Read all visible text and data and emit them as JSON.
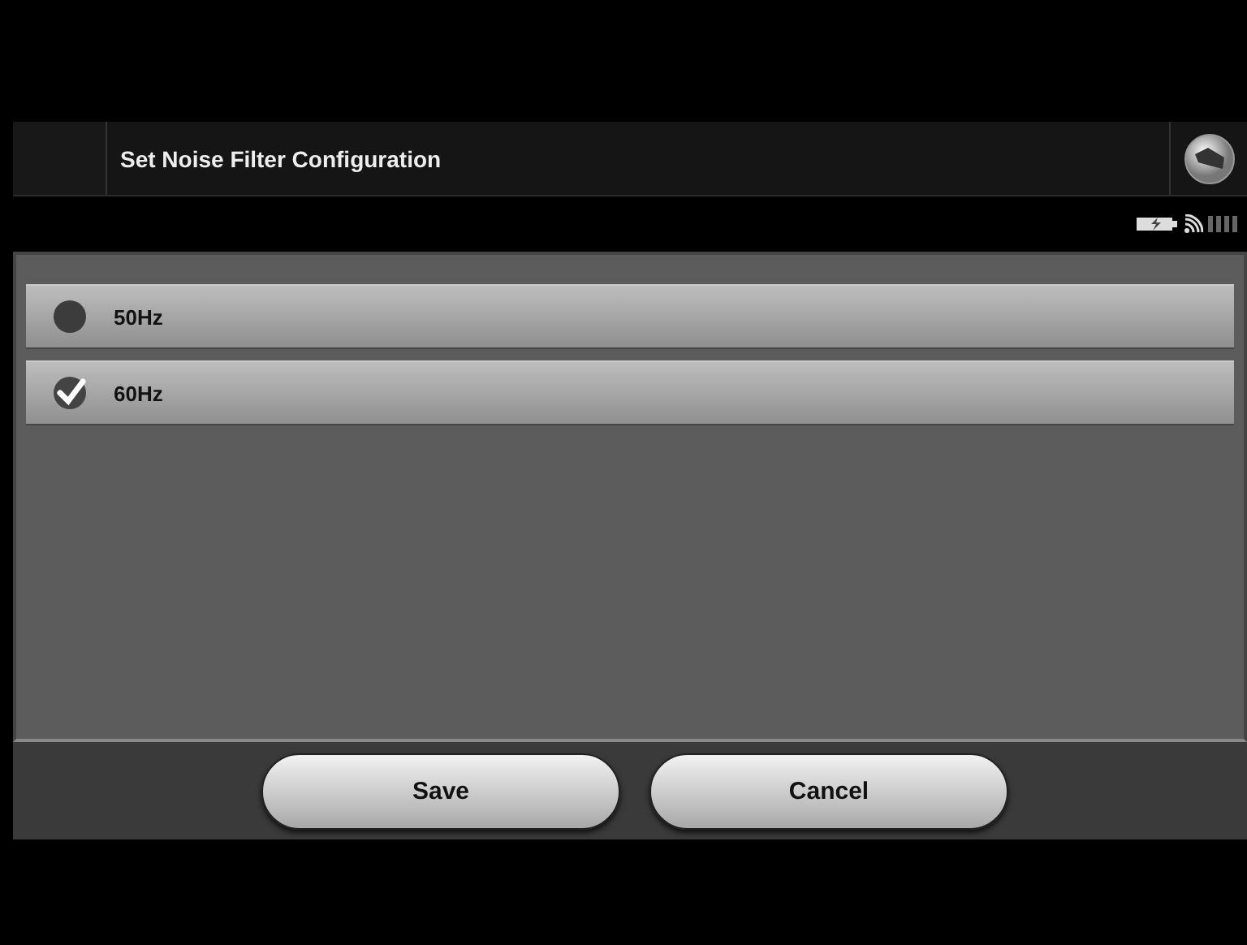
{
  "header": {
    "title": "Set Noise Filter Configuration"
  },
  "options": [
    {
      "label": "50Hz",
      "selected": false
    },
    {
      "label": "60Hz",
      "selected": true
    }
  ],
  "buttons": [
    {
      "label": "Save"
    },
    {
      "label": "Cancel"
    }
  ]
}
